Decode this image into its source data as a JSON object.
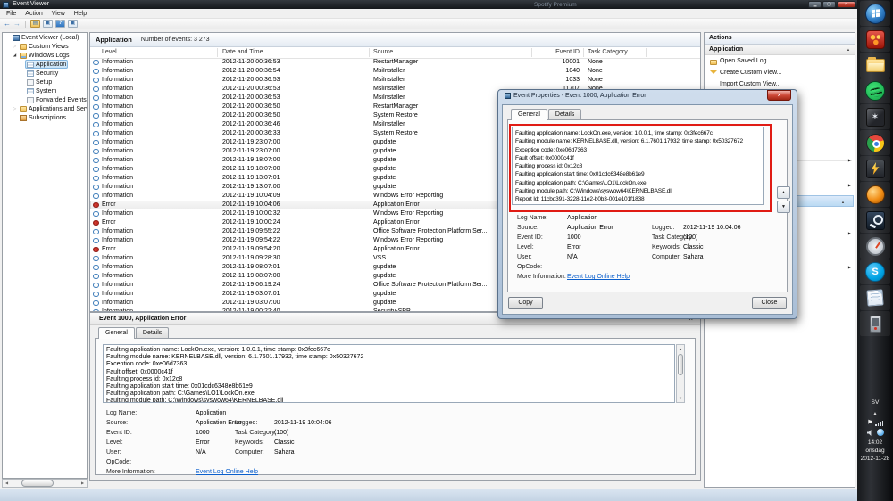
{
  "background": {
    "window_title": "Spotify Premium"
  },
  "titlebar": {
    "title": "Event Viewer"
  },
  "menubar": {
    "items": [
      "File",
      "Action",
      "View",
      "Help"
    ]
  },
  "tree": {
    "items": [
      {
        "label": "Event Viewer (Local)",
        "depth": 0,
        "icon": "root",
        "expander": ""
      },
      {
        "label": "Custom Views",
        "depth": 1,
        "icon": "folder",
        "expander": "collapsed"
      },
      {
        "label": "Windows Logs",
        "depth": 1,
        "icon": "folder-blue",
        "expander": "expanded"
      },
      {
        "label": "Application",
        "depth": 2,
        "icon": "log",
        "expander": "",
        "selected": true
      },
      {
        "label": "Security",
        "depth": 2,
        "icon": "log",
        "expander": ""
      },
      {
        "label": "Setup",
        "depth": 2,
        "icon": "log-plain",
        "expander": ""
      },
      {
        "label": "System",
        "depth": 2,
        "icon": "log",
        "expander": ""
      },
      {
        "label": "Forwarded Events",
        "depth": 2,
        "icon": "log-plain",
        "expander": ""
      },
      {
        "label": "Applications and Services Lo",
        "depth": 1,
        "icon": "folder",
        "expander": "collapsed"
      },
      {
        "label": "Subscriptions",
        "depth": 1,
        "icon": "subs",
        "expander": ""
      }
    ]
  },
  "list": {
    "title": "Application",
    "subtitle": "Number of events: 3 273",
    "columns": [
      "Level",
      "Date and Time",
      "Source",
      "Event ID",
      "Task Category"
    ],
    "rows": [
      {
        "level": "Information",
        "datetime": "2012-11-20 00:36:53",
        "source": "RestartManager",
        "event_id": "10001",
        "task": "None"
      },
      {
        "level": "Information",
        "datetime": "2012-11-20 00:36:54",
        "source": "MsiInstaller",
        "event_id": "1040",
        "task": "None"
      },
      {
        "level": "Information",
        "datetime": "2012-11-20 00:36:53",
        "source": "MsiInstaller",
        "event_id": "1033",
        "task": "None"
      },
      {
        "level": "Information",
        "datetime": "2012-11-20 00:36:53",
        "source": "MsiInstaller",
        "event_id": "11707",
        "task": "None"
      },
      {
        "level": "Information",
        "datetime": "2012-11-20 00:36:53",
        "source": "MsiInstaller",
        "event_id": "",
        "task": ""
      },
      {
        "level": "Information",
        "datetime": "2012-11-20 00:36:50",
        "source": "RestartManager",
        "event_id": "",
        "task": ""
      },
      {
        "level": "Information",
        "datetime": "2012-11-20 00:36:50",
        "source": "System Restore",
        "event_id": "",
        "task": ""
      },
      {
        "level": "Information",
        "datetime": "2012-11-20 00:36:46",
        "source": "MsiInstaller",
        "event_id": "",
        "task": ""
      },
      {
        "level": "Information",
        "datetime": "2012-11-20 00:36:33",
        "source": "System Restore",
        "event_id": "",
        "task": ""
      },
      {
        "level": "Information",
        "datetime": "2012-11-19 23:07:00",
        "source": "gupdate",
        "event_id": "",
        "task": ""
      },
      {
        "level": "Information",
        "datetime": "2012-11-19 23:07:00",
        "source": "gupdate",
        "event_id": "",
        "task": ""
      },
      {
        "level": "Information",
        "datetime": "2012-11-19 18:07:00",
        "source": "gupdate",
        "event_id": "",
        "task": ""
      },
      {
        "level": "Information",
        "datetime": "2012-11-19 18:07:00",
        "source": "gupdate",
        "event_id": "",
        "task": ""
      },
      {
        "level": "Information",
        "datetime": "2012-11-19 13:07:01",
        "source": "gupdate",
        "event_id": "",
        "task": ""
      },
      {
        "level": "Information",
        "datetime": "2012-11-19 13:07:00",
        "source": "gupdate",
        "event_id": "",
        "task": ""
      },
      {
        "level": "Information",
        "datetime": "2012-11-19 10:04:09",
        "source": "Windows Error Reporting",
        "event_id": "",
        "task": ""
      },
      {
        "level": "Error",
        "datetime": "2012-11-19 10:04:06",
        "source": "Application Error",
        "event_id": "",
        "task": "",
        "selected": true
      },
      {
        "level": "Information",
        "datetime": "2012-11-19 10:00:32",
        "source": "Windows Error Reporting",
        "event_id": "",
        "task": ""
      },
      {
        "level": "Error",
        "datetime": "2012-11-19 10:00:24",
        "source": "Application Error",
        "event_id": "",
        "task": ""
      },
      {
        "level": "Information",
        "datetime": "2012-11-19 09:55:22",
        "source": "Office Software Protection Platform Ser...",
        "event_id": "",
        "task": ""
      },
      {
        "level": "Information",
        "datetime": "2012-11-19 09:54:22",
        "source": "Windows Error Reporting",
        "event_id": "",
        "task": ""
      },
      {
        "level": "Error",
        "datetime": "2012-11-19 09:54:20",
        "source": "Application Error",
        "event_id": "",
        "task": ""
      },
      {
        "level": "Information",
        "datetime": "2012-11-19 09:28:30",
        "source": "VSS",
        "event_id": "",
        "task": ""
      },
      {
        "level": "Information",
        "datetime": "2012-11-19 08:07:01",
        "source": "gupdate",
        "event_id": "",
        "task": ""
      },
      {
        "level": "Information",
        "datetime": "2012-11-19 08:07:00",
        "source": "gupdate",
        "event_id": "",
        "task": ""
      },
      {
        "level": "Information",
        "datetime": "2012-11-19 06:19:24",
        "source": "Office Software Protection Platform Ser...",
        "event_id": "",
        "task": ""
      },
      {
        "level": "Information",
        "datetime": "2012-11-19 03:07:01",
        "source": "gupdate",
        "event_id": "",
        "task": ""
      },
      {
        "level": "Information",
        "datetime": "2012-11-19 03:07:00",
        "source": "gupdate",
        "event_id": "",
        "task": ""
      },
      {
        "level": "Information",
        "datetime": "2012-11-19 00:22:40",
        "source": "Security-SPP",
        "event_id": "",
        "task": ""
      }
    ]
  },
  "actions": {
    "title": "Actions",
    "section": "Application",
    "items": [
      {
        "label": "Open Saved Log...",
        "icon": "open-log-folder"
      },
      {
        "label": "Create Custom View...",
        "icon": "filter"
      },
      {
        "label": "Import Custom View...",
        "icon": ""
      }
    ]
  },
  "event": {
    "description_lines": [
      "Faulting application name: LockOn.exe, version: 1.0.0.1, time stamp: 0x3fec667c",
      "Faulting module name: KERNELBASE.dll, version: 6.1.7601.17932, time stamp: 0x50327672",
      "Exception code: 0xe06d7363",
      "Fault offset: 0x0000c41f",
      "Faulting process id: 0x12c8",
      "Faulting application start time: 0x01cdc6348e8b61e9",
      "Faulting application path: C:\\Games\\LO1\\LockOn.exe",
      "Faulting module path: C:\\Windows\\syswow64\\KERNELBASE.dll",
      "Report Id: 11cbd391-3228-11e2-b0b3-001e101f1838"
    ],
    "field_rows": [
      {
        "l": "Log Name:",
        "lv": "Application",
        "r": "",
        "rv": ""
      },
      {
        "l": "Source:",
        "lv": "Application Error",
        "r": "Logged:",
        "rv": "2012-11-19 10:04:06"
      },
      {
        "l": "Event ID:",
        "lv": "1000",
        "r": "Task Category:",
        "rv": "(100)"
      },
      {
        "l": "Level:",
        "lv": "Error",
        "r": "Keywords:",
        "rv": "Classic"
      },
      {
        "l": "User:",
        "lv": "N/A",
        "r": "Computer:",
        "rv": "Sahara"
      },
      {
        "l": "OpCode:",
        "lv": "",
        "r": "",
        "rv": ""
      },
      {
        "l": "More Information:",
        "lv": "Event Log Online Help",
        "link": true,
        "r": "",
        "rv": ""
      }
    ]
  },
  "dialog": {
    "title": "Event Properties - Event 1000, Application Error",
    "tabs": [
      "General",
      "Details"
    ],
    "copy_label": "Copy",
    "close_label": "Close"
  },
  "preview": {
    "title": "Event 1000, Application Error",
    "tabs": [
      "General",
      "Details"
    ]
  },
  "taskbar": {
    "icons": [
      {
        "name": "start-button",
        "cls": "start"
      },
      {
        "name": "red-app-icon",
        "cls": "redapp"
      },
      {
        "name": "windows-explorer-icon",
        "cls": "explorer"
      },
      {
        "name": "spotify-icon",
        "cls": "spotify"
      },
      {
        "name": "game-crystal-icon",
        "cls": "crystal",
        "glyph": "✶"
      },
      {
        "name": "chrome-icon",
        "cls": "chrome"
      },
      {
        "name": "winamp-icon",
        "cls": "winamp"
      },
      {
        "name": "orange-app-icon",
        "cls": "orange"
      },
      {
        "name": "steam-icon",
        "cls": "steam"
      },
      {
        "name": "gauge-app-icon",
        "cls": "gauge"
      },
      {
        "name": "skype-icon",
        "cls": "skype",
        "glyph": "S"
      },
      {
        "name": "notes-app-icon",
        "cls": "notes"
      },
      {
        "name": "phone-app-icon",
        "cls": "phone"
      }
    ],
    "tray": {
      "language": "SV",
      "time": "14:02",
      "day": "onsdag",
      "date": "2012-11-28"
    }
  },
  "colors": {
    "annotation_red": "#e01b14",
    "error_red": "#c62f26",
    "info_blue": "#3c7bb8",
    "link_blue": "#0b5fcc",
    "selection_blue": "#c3e0f5"
  }
}
